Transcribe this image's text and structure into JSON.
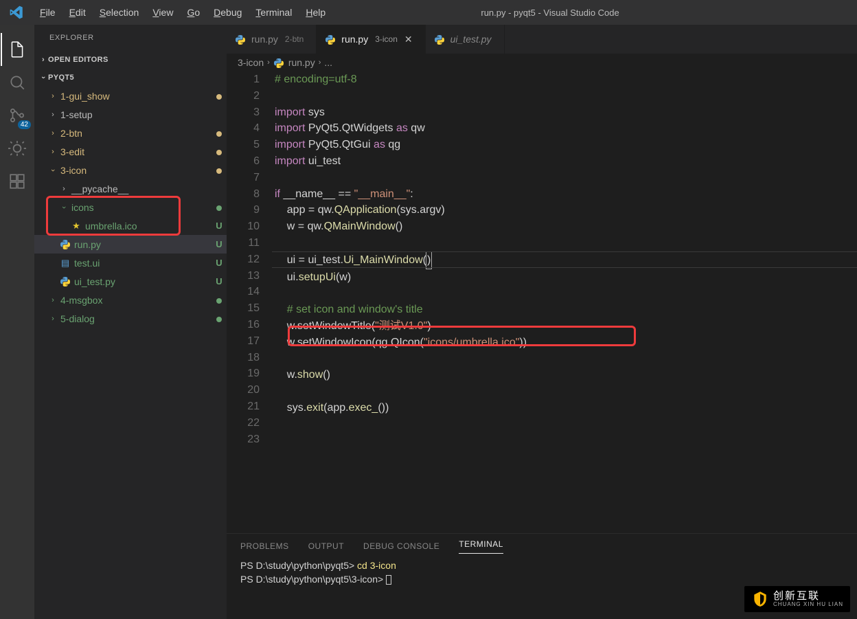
{
  "title": "run.py - pyqt5 - Visual Studio Code",
  "menu": {
    "file": "File",
    "edit": "Edit",
    "selection": "Selection",
    "view": "View",
    "go": "Go",
    "debug": "Debug",
    "terminal": "Terminal",
    "help": "Help"
  },
  "activitybar": {
    "scm_badge": "42"
  },
  "sidebar": {
    "heading": "EXPLORER",
    "open_editors": "OPEN EDITORS",
    "project": "PYQT5",
    "tree": {
      "gui_show": "1-gui_show",
      "setup": "1-setup",
      "btn": "2-btn",
      "edit": "3-edit",
      "icon": "3-icon",
      "pycache": "__pycache__",
      "icons": "icons",
      "umbrella": "umbrella.ico",
      "run": "run.py",
      "testui": "test.ui",
      "uitest": "ui_test.py",
      "msgbox": "4-msgbox",
      "dialog": "5-dialog"
    },
    "status": {
      "U": "U"
    }
  },
  "tabs": {
    "t1": {
      "name": "run.py",
      "desc": "2-btn"
    },
    "t2": {
      "name": "run.py",
      "desc": "3-icon"
    },
    "t3": {
      "name": "ui_test.py",
      "desc": ""
    }
  },
  "breadcrumb": {
    "a": "3-icon",
    "b": "run.py",
    "c": "..."
  },
  "code": {
    "lines": 23,
    "l1": "# encoding=utf-8",
    "l3a": "import",
    "l3b": " sys",
    "l4a": "import",
    "l4b": " PyQt5.QtWidgets ",
    "l4c": "as",
    "l4d": " qw",
    "l5a": "import",
    "l5b": " PyQt5.QtGui ",
    "l5c": "as",
    "l5d": " qg",
    "l6a": "import",
    "l6b": " ui_test",
    "l8a": "if",
    "l8b": " __name__ == ",
    "l8c": "\"__main__\"",
    "l8d": ":",
    "l9": "    app = qw.QApplication(sys.argv)",
    "l10": "    w = qw.QMainWindow()",
    "l12": "    ui = ui_test.Ui_MainWindow()",
    "l13": "    ui.setupUi(w)",
    "l15": "    # set icon and window's title",
    "l16a": "    w.setWindowTitle(",
    "l16b": "\"测试V1.0\"",
    "l16c": ")",
    "l17a": "    w.setWindowIcon(qg.QIcon(",
    "l17b": "\"icons/umbrella.ico\"",
    "l17c": "))",
    "l19": "    w.show()",
    "l21": "    sys.exit(app.exec_())"
  },
  "panel": {
    "tabs": {
      "problems": "PROBLEMS",
      "output": "OUTPUT",
      "debug": "DEBUG CONSOLE",
      "terminal": "TERMINAL"
    },
    "line1": {
      "prompt": "PS D:\\study\\python\\pyqt5> ",
      "cmd": "cd 3-icon"
    },
    "line2": {
      "prompt": "PS D:\\study\\python\\pyqt5\\3-icon> "
    }
  },
  "watermark": {
    "cn": "创新互联",
    "en": "CHUANG XIN HU LIAN"
  }
}
